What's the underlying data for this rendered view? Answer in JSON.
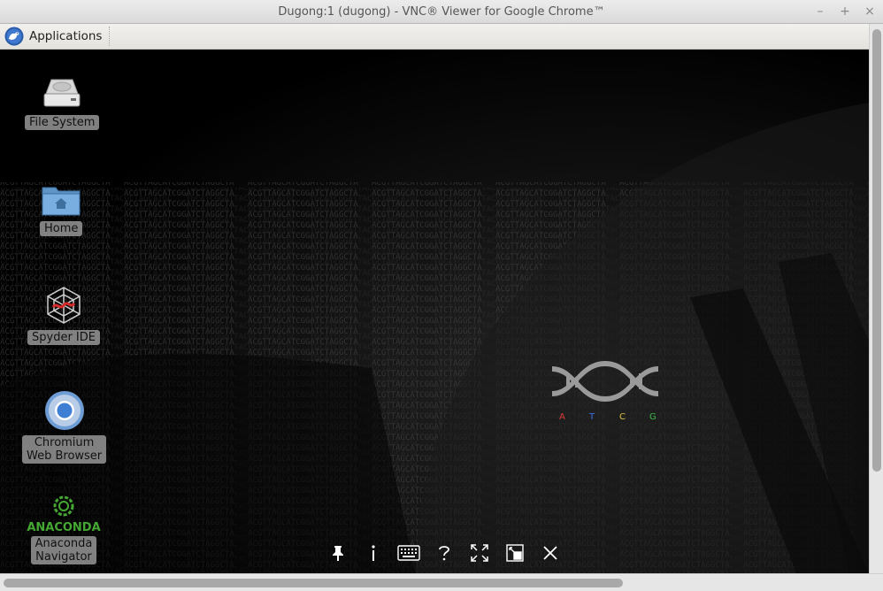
{
  "window": {
    "title": "Dugong:1 (dugong) - VNC® Viewer for Google Chrome™",
    "controls": [
      "–",
      "+",
      "×"
    ]
  },
  "panel": {
    "applications_label": "Applications"
  },
  "desktop_icons": [
    {
      "label": "File System",
      "icon": "hard-drive-icon"
    },
    {
      "label": "Home",
      "icon": "home-folder-icon"
    },
    {
      "label": "Spyder IDE",
      "icon": "spyder-icon"
    },
    {
      "label_line1": "Chromium",
      "label_line2": "Web Browser",
      "icon": "chromium-icon"
    },
    {
      "label_line1": "Anaconda",
      "label_line2": "Navigator",
      "icon": "anaconda-icon"
    }
  ],
  "anaconda_logo_text": "ANACONDA",
  "dna_logo": {
    "letters": [
      "A",
      "T",
      "C",
      "G"
    ],
    "colors": [
      "#e03a3a",
      "#3a6ee0",
      "#e0c23a",
      "#3ab84a"
    ]
  },
  "vnc_toolbar": [
    "pin-icon",
    "info-icon",
    "keyboard-icon",
    "help-icon",
    "fullscreen-icon",
    "scale-icon",
    "close-icon"
  ]
}
